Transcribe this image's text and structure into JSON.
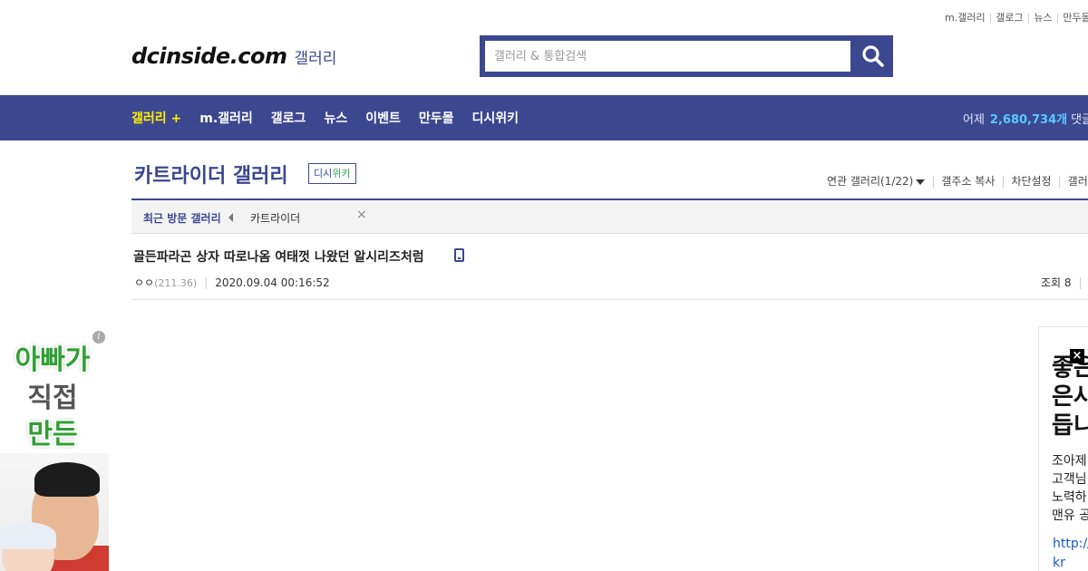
{
  "top_links": [
    "m.갤러리",
    "갤로그",
    "뉴스",
    "만두몰"
  ],
  "logo": {
    "main": "dcinside.com",
    "sub": "갤러리"
  },
  "search": {
    "placeholder": "갤러리 & 통합검색"
  },
  "nav": {
    "items": [
      "갤러리 +",
      "m.갤러리",
      "갤로그",
      "뉴스",
      "이벤트",
      "만두몰",
      "디시위키"
    ],
    "stats_label": "어제",
    "stats_value": "2,680,734개",
    "stats_suffix": "댓글"
  },
  "gallery": {
    "title": "카트라이더 갤러리",
    "wiki_prefix": "디시",
    "wiki_suffix": "위키",
    "options": [
      "연관 갤러리(1/22)",
      "갤주소 복사",
      "차단설정",
      "갤러리"
    ]
  },
  "recent": {
    "label": "최근 방문 갤러리",
    "items": [
      "카트라이더"
    ],
    "close": "×"
  },
  "post": {
    "title": "골든파라곤 상자 따로나옴 여태껏 나왔던 알시리즈처럼",
    "author": "ㅇㅇ",
    "ip": "(211.36)",
    "datetime": "2020.09.04 00:16:52",
    "views_label": "조회 8"
  },
  "ad_left": {
    "line1": "아빠가",
    "line2": "직접",
    "line3": "만든",
    "info": "i",
    "colors": {
      "green": "#2fa033"
    }
  },
  "ad_right": {
    "heading": [
      "좋은",
      "은사",
      "듭니"
    ],
    "body": [
      "조아제",
      "고객님",
      "노력하",
      "맨유 공"
    ],
    "link": [
      "http://w",
      "kr"
    ],
    "close": "×"
  },
  "colors": {
    "brand": "#3b4890",
    "nav_active": "#ffee00",
    "stats_number": "#5bc8ff"
  }
}
